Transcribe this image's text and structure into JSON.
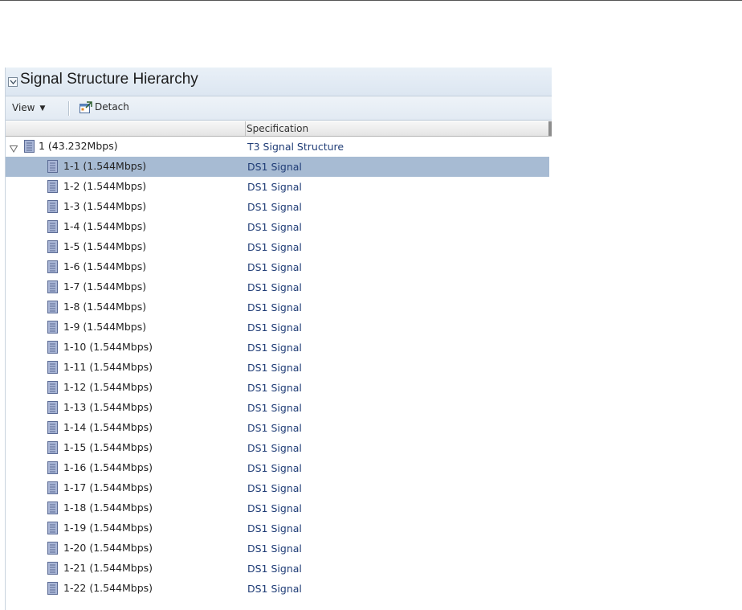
{
  "panel": {
    "title": "Signal Structure Hierarchy"
  },
  "toolbar": {
    "view_label": "View",
    "detach_label": "Detach"
  },
  "table": {
    "columns": [
      "",
      "Specification"
    ]
  },
  "tree": {
    "root": {
      "label": "1 (43.232Mbps)",
      "spec": "T3 Signal Structure",
      "expanded": true
    },
    "children": [
      {
        "label": "1-1 (1.544Mbps)",
        "spec": "DS1 Signal",
        "selected": true
      },
      {
        "label": "1-2 (1.544Mbps)",
        "spec": "DS1 Signal"
      },
      {
        "label": "1-3 (1.544Mbps)",
        "spec": "DS1 Signal"
      },
      {
        "label": "1-4 (1.544Mbps)",
        "spec": "DS1 Signal"
      },
      {
        "label": "1-5 (1.544Mbps)",
        "spec": "DS1 Signal"
      },
      {
        "label": "1-6 (1.544Mbps)",
        "spec": "DS1 Signal"
      },
      {
        "label": "1-7 (1.544Mbps)",
        "spec": "DS1 Signal"
      },
      {
        "label": "1-8 (1.544Mbps)",
        "spec": "DS1 Signal"
      },
      {
        "label": "1-9 (1.544Mbps)",
        "spec": "DS1 Signal"
      },
      {
        "label": "1-10 (1.544Mbps)",
        "spec": "DS1 Signal"
      },
      {
        "label": "1-11 (1.544Mbps)",
        "spec": "DS1 Signal"
      },
      {
        "label": "1-12 (1.544Mbps)",
        "spec": "DS1 Signal"
      },
      {
        "label": "1-13 (1.544Mbps)",
        "spec": "DS1 Signal"
      },
      {
        "label": "1-14 (1.544Mbps)",
        "spec": "DS1 Signal"
      },
      {
        "label": "1-15 (1.544Mbps)",
        "spec": "DS1 Signal"
      },
      {
        "label": "1-16 (1.544Mbps)",
        "spec": "DS1 Signal"
      },
      {
        "label": "1-17 (1.544Mbps)",
        "spec": "DS1 Signal"
      },
      {
        "label": "1-18 (1.544Mbps)",
        "spec": "DS1 Signal"
      },
      {
        "label": "1-19 (1.544Mbps)",
        "spec": "DS1 Signal"
      },
      {
        "label": "1-20 (1.544Mbps)",
        "spec": "DS1 Signal"
      },
      {
        "label": "1-21 (1.544Mbps)",
        "spec": "DS1 Signal"
      },
      {
        "label": "1-22 (1.544Mbps)",
        "spec": "DS1 Signal"
      }
    ]
  },
  "colors": {
    "selection": "#a7bbd3",
    "spec_text": "#1f3c76",
    "header_bg": "#dce6f1",
    "node_icon": "#8f9fc4"
  },
  "icons": {
    "collapse": "chevron-down-icon",
    "expander": "triangle-down-icon",
    "node": "signal-node-icon",
    "detach": "detach-icon"
  }
}
